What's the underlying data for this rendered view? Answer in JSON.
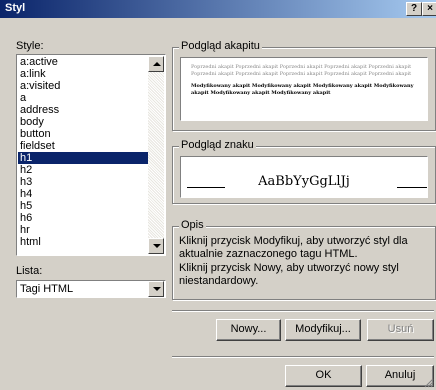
{
  "window": {
    "title": "Styl",
    "help_label": "?",
    "close_label": "×"
  },
  "styles_label": "Style:",
  "styles": [
    "a:active",
    "a:link",
    "a:visited",
    "a",
    "address",
    "body",
    "button",
    "fieldset",
    "h1",
    "h2",
    "h3",
    "h4",
    "h5",
    "h6",
    "hr",
    "html"
  ],
  "selected_style": "h1",
  "list_label": "Lista:",
  "list_value": "Tagi HTML",
  "paragraph_preview": {
    "label": "Podgląd akapitu",
    "normal_text": "Poprzedni akapit Poprzedni akapit Poprzedni akapit Poprzedni akapit Poprzedni akapit Poprzedni akapit Poprzedni akapit Poprzedni akapit Poprzedni akapit Poprzedni akapit",
    "modified_text": "Modyfikowany akapit Modyfikowany akapit Modyfikowany akapit Modyfikowany akapit Modyfikowany akapit Modyfikowany akapit"
  },
  "char_preview": {
    "label": "Podgląd znaku",
    "sample": "AaBbYyGgLlJj"
  },
  "description": {
    "label": "Opis",
    "text1": "Kliknij przycisk Modyfikuj, aby utworzyć styl dla aktualnie zaznaczonego tagu HTML.",
    "text2": "Kliknij przycisk Nowy, aby utworzyć nowy styl niestandardowy."
  },
  "buttons": {
    "new": "Nowy...",
    "modify": "Modyfikuj...",
    "delete": "Usuń",
    "ok": "OK",
    "cancel": "Anuluj"
  },
  "colors": {
    "title_start": "#0a246a",
    "title_end": "#a6caf0",
    "selection": "#0a246a",
    "face": "#d4d0c8"
  }
}
